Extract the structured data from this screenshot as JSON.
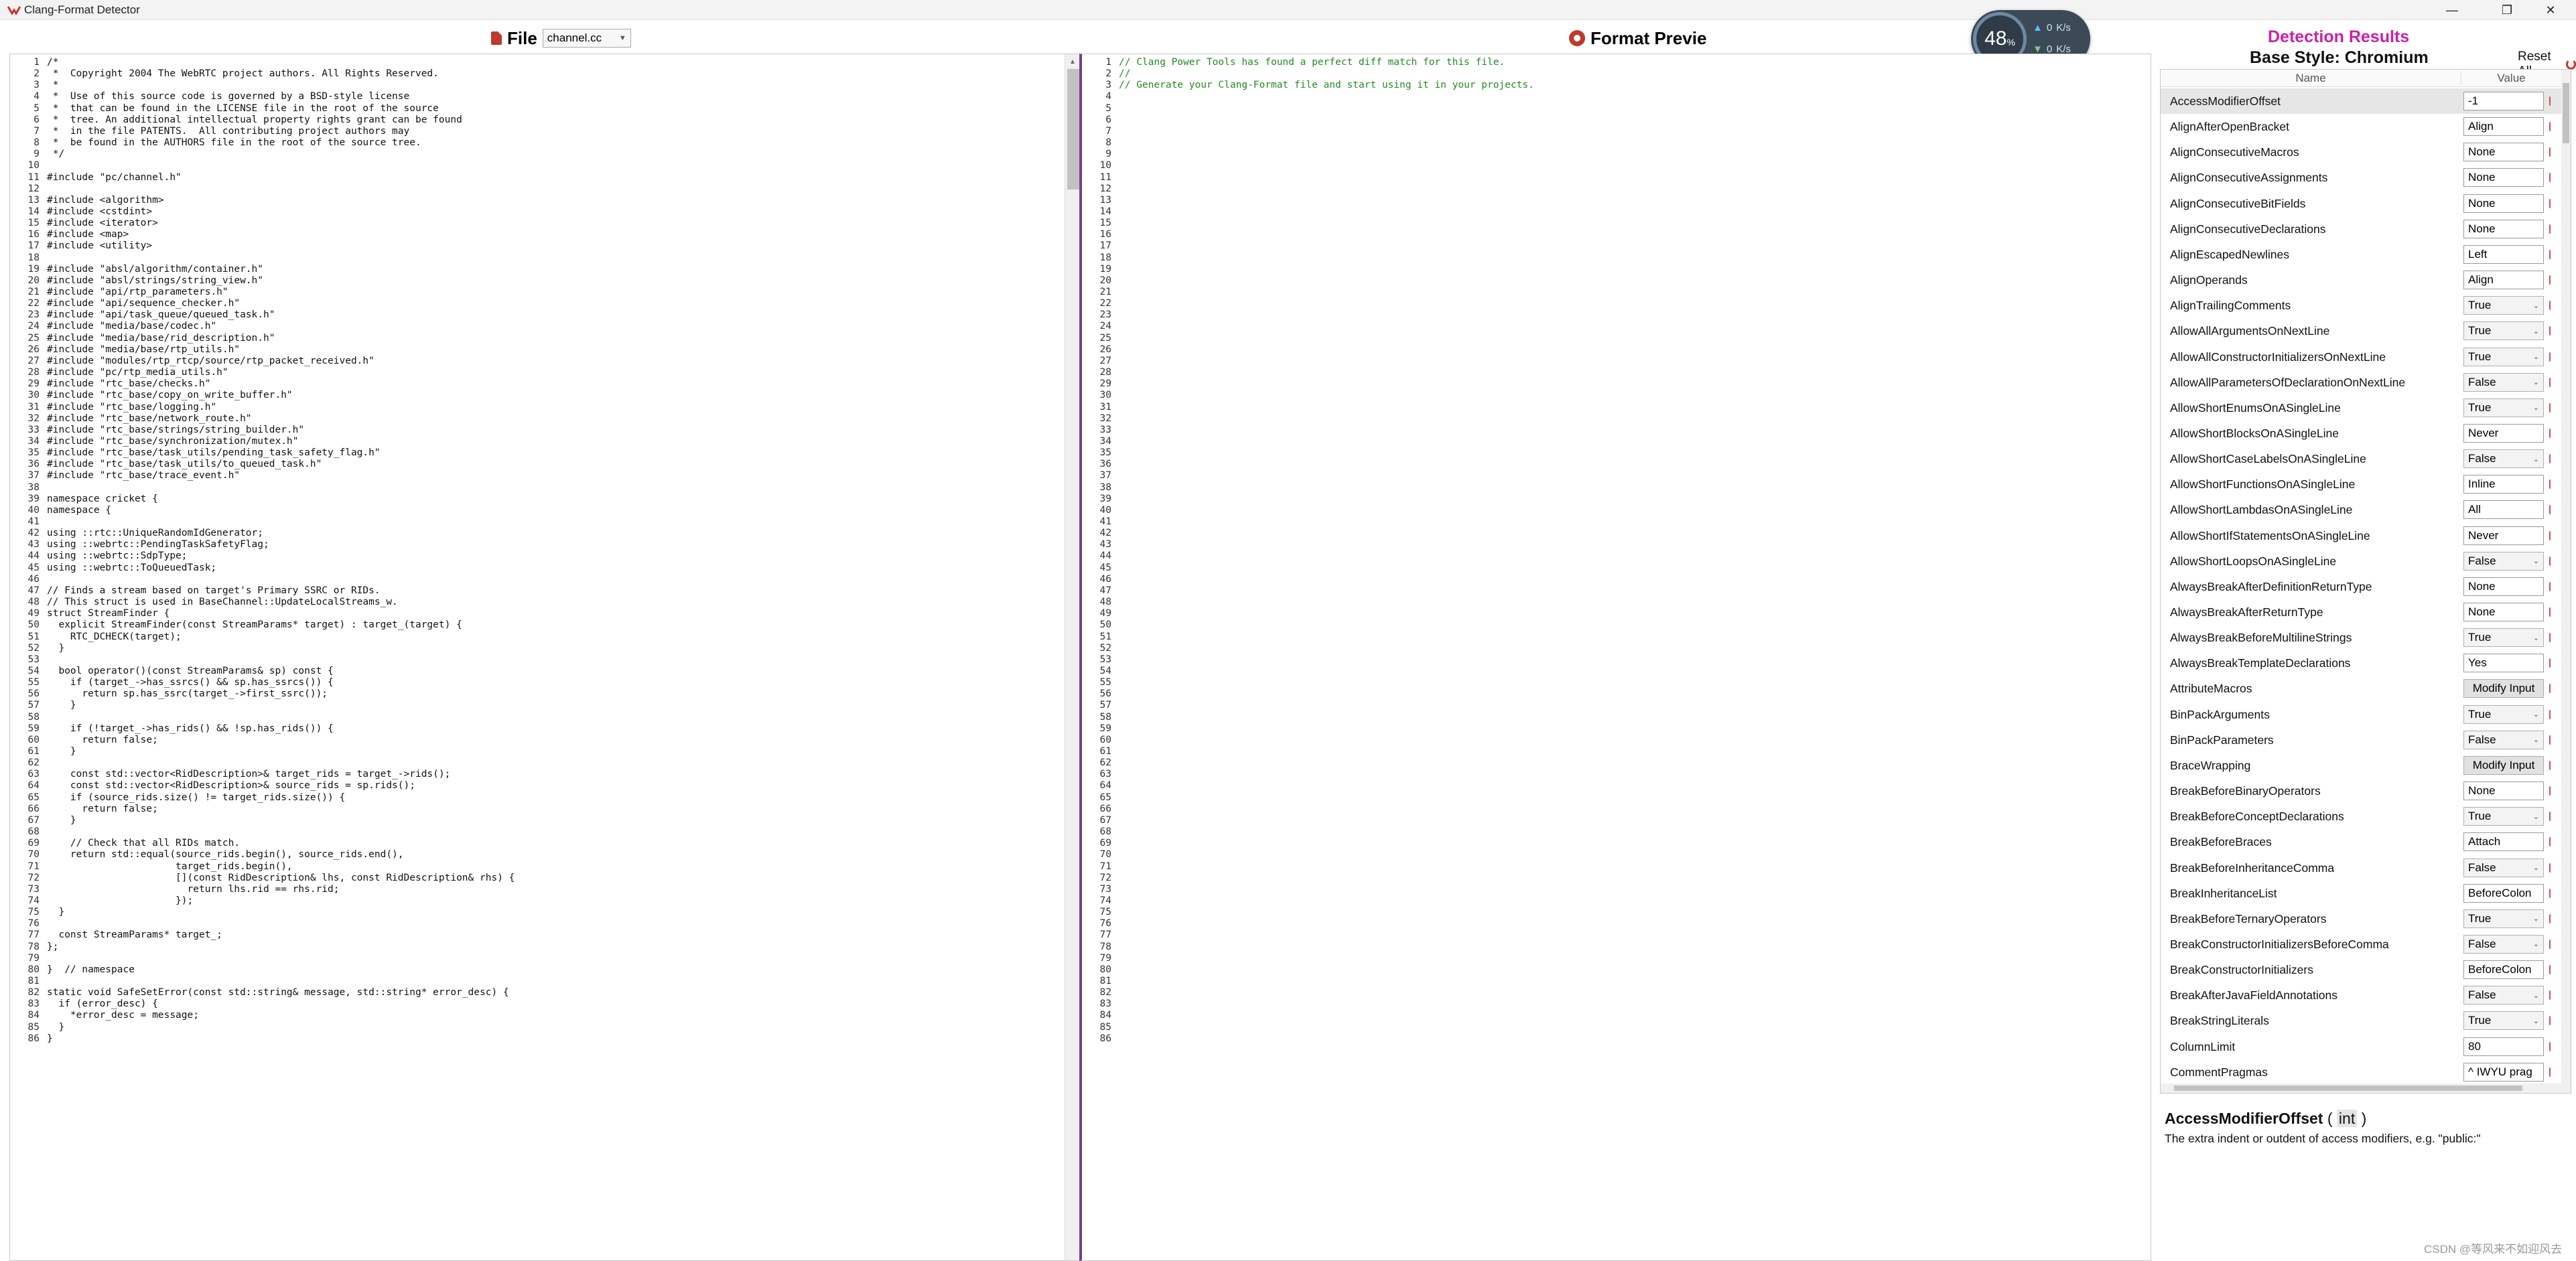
{
  "window": {
    "title": "Clang-Format Detector",
    "minimize": "—",
    "maximize": "❐",
    "close": "✕"
  },
  "file_header": {
    "label": "File",
    "selected_file": "channel.cc"
  },
  "preview_header": {
    "label": "Format Previe"
  },
  "net_widget": {
    "percent": "48",
    "percent_unit": "%",
    "upload": "0",
    "upload_unit": "K/s",
    "download": "0",
    "download_unit": "K/s"
  },
  "source_code": {
    "lines": [
      "/*",
      " *  Copyright 2004 The WebRTC project authors. All Rights Reserved.",
      " *",
      " *  Use of this source code is governed by a BSD-style license",
      " *  that can be found in the LICENSE file in the root of the source",
      " *  tree. An additional intellectual property rights grant can be found",
      " *  in the file PATENTS.  All contributing project authors may",
      " *  be found in the AUTHORS file in the root of the source tree.",
      " */",
      "",
      "#include \"pc/channel.h\"",
      "",
      "#include <algorithm>",
      "#include <cstdint>",
      "#include <iterator>",
      "#include <map>",
      "#include <utility>",
      "",
      "#include \"absl/algorithm/container.h\"",
      "#include \"absl/strings/string_view.h\"",
      "#include \"api/rtp_parameters.h\"",
      "#include \"api/sequence_checker.h\"",
      "#include \"api/task_queue/queued_task.h\"",
      "#include \"media/base/codec.h\"",
      "#include \"media/base/rid_description.h\"",
      "#include \"media/base/rtp_utils.h\"",
      "#include \"modules/rtp_rtcp/source/rtp_packet_received.h\"",
      "#include \"pc/rtp_media_utils.h\"",
      "#include \"rtc_base/checks.h\"",
      "#include \"rtc_base/copy_on_write_buffer.h\"",
      "#include \"rtc_base/logging.h\"",
      "#include \"rtc_base/network_route.h\"",
      "#include \"rtc_base/strings/string_builder.h\"",
      "#include \"rtc_base/synchronization/mutex.h\"",
      "#include \"rtc_base/task_utils/pending_task_safety_flag.h\"",
      "#include \"rtc_base/task_utils/to_queued_task.h\"",
      "#include \"rtc_base/trace_event.h\"",
      "",
      "namespace cricket {",
      "namespace {",
      "",
      "using ::rtc::UniqueRandomIdGenerator;",
      "using ::webrtc::PendingTaskSafetyFlag;",
      "using ::webrtc::SdpType;",
      "using ::webrtc::ToQueuedTask;",
      "",
      "// Finds a stream based on target's Primary SSRC or RIDs.",
      "// This struct is used in BaseChannel::UpdateLocalStreams_w.",
      "struct StreamFinder {",
      "  explicit StreamFinder(const StreamParams* target) : target_(target) {",
      "    RTC_DCHECK(target);",
      "  }",
      "",
      "  bool operator()(const StreamParams& sp) const {",
      "    if (target_->has_ssrcs() && sp.has_ssrcs()) {",
      "      return sp.has_ssrc(target_->first_ssrc());",
      "    }",
      "",
      "    if (!target_->has_rids() && !sp.has_rids()) {",
      "      return false;",
      "    }",
      "",
      "    const std::vector<RidDescription>& target_rids = target_->rids();",
      "    const std::vector<RidDescription>& source_rids = sp.rids();",
      "    if (source_rids.size() != target_rids.size()) {",
      "      return false;",
      "    }",
      "",
      "    // Check that all RIDs match.",
      "    return std::equal(source_rids.begin(), source_rids.end(),",
      "                      target_rids.begin(),",
      "                      [](const RidDescription& lhs, const RidDescription& rhs) {",
      "                        return lhs.rid == rhs.rid;",
      "                      });",
      "  }",
      "",
      "  const StreamParams* target_;",
      "};",
      "",
      "}  // namespace",
      "",
      "static void SafeSetError(const std::string& message, std::string* error_desc) {",
      "  if (error_desc) {",
      "    *error_desc = message;",
      "  }",
      "}"
    ]
  },
  "preview_code": {
    "lines": [
      "// Clang Power Tools has found a perfect diff match for this file.",
      "//",
      "// Generate your Clang-Format file and start using it in your projects."
    ],
    "line_count": 86
  },
  "results": {
    "title": "Detection Results",
    "base_style": "Base Style: Chromium",
    "reset_label": "Reset All",
    "col_name": "Name",
    "col_value": "Value",
    "rows": [
      {
        "name": "AccessModifierOffset",
        "value": "-1",
        "kind": "input",
        "selected": true
      },
      {
        "name": "AlignAfterOpenBracket",
        "value": "Align",
        "kind": "input"
      },
      {
        "name": "AlignConsecutiveMacros",
        "value": "None",
        "kind": "input"
      },
      {
        "name": "AlignConsecutiveAssignments",
        "value": "None",
        "kind": "input"
      },
      {
        "name": "AlignConsecutiveBitFields",
        "value": "None",
        "kind": "input"
      },
      {
        "name": "AlignConsecutiveDeclarations",
        "value": "None",
        "kind": "input"
      },
      {
        "name": "AlignEscapedNewlines",
        "value": "Left",
        "kind": "input"
      },
      {
        "name": "AlignOperands",
        "value": "Align",
        "kind": "input"
      },
      {
        "name": "AlignTrailingComments",
        "value": "True",
        "kind": "select"
      },
      {
        "name": "AllowAllArgumentsOnNextLine",
        "value": "True",
        "kind": "select"
      },
      {
        "name": "AllowAllConstructorInitializersOnNextLine",
        "value": "True",
        "kind": "select"
      },
      {
        "name": "AllowAllParametersOfDeclarationOnNextLine",
        "value": "False",
        "kind": "select"
      },
      {
        "name": "AllowShortEnumsOnASingleLine",
        "value": "True",
        "kind": "select"
      },
      {
        "name": "AllowShortBlocksOnASingleLine",
        "value": "Never",
        "kind": "input"
      },
      {
        "name": "AllowShortCaseLabelsOnASingleLine",
        "value": "False",
        "kind": "select"
      },
      {
        "name": "AllowShortFunctionsOnASingleLine",
        "value": "Inline",
        "kind": "input"
      },
      {
        "name": "AllowShortLambdasOnASingleLine",
        "value": "All",
        "kind": "input"
      },
      {
        "name": "AllowShortIfStatementsOnASingleLine",
        "value": "Never",
        "kind": "input"
      },
      {
        "name": "AllowShortLoopsOnASingleLine",
        "value": "False",
        "kind": "select"
      },
      {
        "name": "AlwaysBreakAfterDefinitionReturnType",
        "value": "None",
        "kind": "input"
      },
      {
        "name": "AlwaysBreakAfterReturnType",
        "value": "None",
        "kind": "input"
      },
      {
        "name": "AlwaysBreakBeforeMultilineStrings",
        "value": "True",
        "kind": "select"
      },
      {
        "name": "AlwaysBreakTemplateDeclarations",
        "value": "Yes",
        "kind": "input"
      },
      {
        "name": "AttributeMacros",
        "value": "Modify Input",
        "kind": "button"
      },
      {
        "name": "BinPackArguments",
        "value": "True",
        "kind": "select"
      },
      {
        "name": "BinPackParameters",
        "value": "False",
        "kind": "select"
      },
      {
        "name": "BraceWrapping",
        "value": "Modify Input",
        "kind": "button"
      },
      {
        "name": "BreakBeforeBinaryOperators",
        "value": "None",
        "kind": "input"
      },
      {
        "name": "BreakBeforeConceptDeclarations",
        "value": "True",
        "kind": "select"
      },
      {
        "name": "BreakBeforeBraces",
        "value": "Attach",
        "kind": "input"
      },
      {
        "name": "BreakBeforeInheritanceComma",
        "value": "False",
        "kind": "select"
      },
      {
        "name": "BreakInheritanceList",
        "value": "BeforeColon",
        "kind": "input"
      },
      {
        "name": "BreakBeforeTernaryOperators",
        "value": "True",
        "kind": "select"
      },
      {
        "name": "BreakConstructorInitializersBeforeComma",
        "value": "False",
        "kind": "select"
      },
      {
        "name": "BreakConstructorInitializers",
        "value": "BeforeColon",
        "kind": "input"
      },
      {
        "name": "BreakAfterJavaFieldAnnotations",
        "value": "False",
        "kind": "select"
      },
      {
        "name": "BreakStringLiterals",
        "value": "True",
        "kind": "select"
      },
      {
        "name": "ColumnLimit",
        "value": "80",
        "kind": "input"
      },
      {
        "name": "CommentPragmas",
        "value": "^ IWYU prag",
        "kind": "input"
      }
    ]
  },
  "description": {
    "name": "AccessModifierOffset",
    "type_open": " ( ",
    "type": "int",
    "type_close": " )",
    "text": "The extra indent or outdent of access modifiers, e.g. \"public:\""
  },
  "watermark": "CSDN @等风来不如迎风去"
}
